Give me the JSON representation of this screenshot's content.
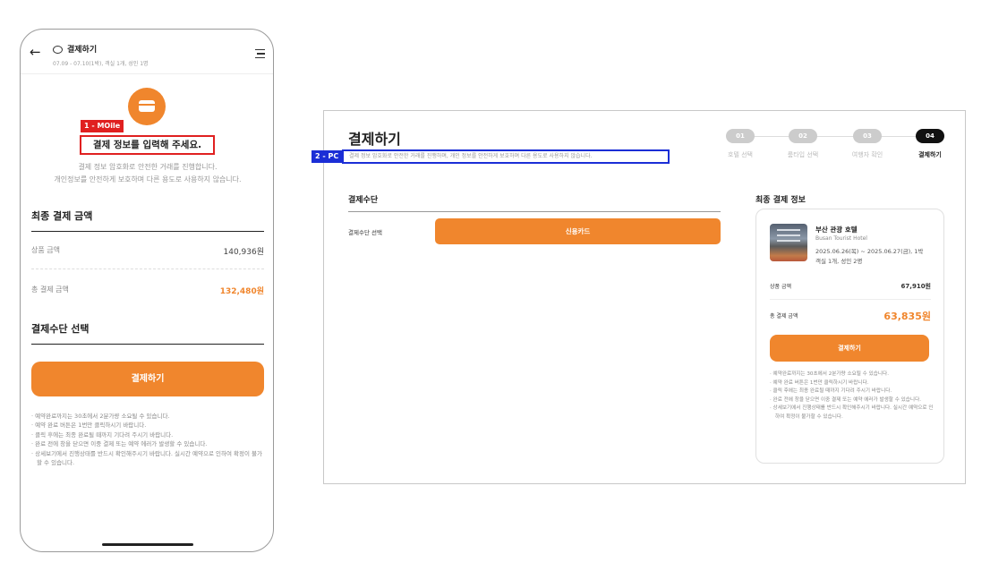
{
  "mobile": {
    "header": {
      "title": "결제하기",
      "subtitle": "07.09 - 07.10(1박), 객실 1개, 성인 1명"
    },
    "badge": "1 - MOile",
    "main_title": "결제 정보를 입력해 주세요.",
    "description_line1": "결제 정보 암호화로 안전한 거래를 진행합니다.",
    "description_line2": "개인정보를 안전하게 보호하며 다른 용도로 사용하지 않습니다.",
    "final_amount_title": "최종 결제 금액",
    "product_label": "상품 금액",
    "product_value": "140,936원",
    "total_label": "총 결제 금액",
    "total_value": "132,480원",
    "payment_method_title": "결제수단 선택",
    "pay_button": "결제하기",
    "notes": [
      "· 예약완료까지는 30초에서 2분가량 소요될 수 있습니다.",
      "· 예약 완료 버튼은 1번만 클릭하시기 바랍니다.",
      "· 클릭 후에는 최종 완료될 때까지 기다려 주시기 바랍니다.",
      "· 완료 전에 창을 닫으면 이중 결제 또는 예약 에러가 발생할 수 있습니다.",
      "· 상세보기에서 진행상태를 반드시 확인해주시기 바랍니다. 실시간 예약으로 인하여 확정이 불가할 수 있습니다."
    ]
  },
  "pc": {
    "title": "결제하기",
    "badge": "2 - PC",
    "description": "결제 정보 암호화로 안전한 거래를 진행하며, 개인 정보를 안전하게 보호하며 다른 용도로 사용하지 않습니다.",
    "steps": [
      {
        "num": "01",
        "label": "호텔 선택"
      },
      {
        "num": "02",
        "label": "룸타입 선택"
      },
      {
        "num": "03",
        "label": "여행자 확인"
      },
      {
        "num": "04",
        "label": "결제하기"
      }
    ],
    "payment_section_title": "결제수단",
    "payment_method_label": "결제수단 선택",
    "credit_card_button": "신용카드",
    "summary": {
      "title": "최종 결제 정보",
      "hotel_name": "부산 관광 호텔",
      "hotel_name_en": "Busan Tourist Hotel",
      "dates": "2025.06.26(목) ~ 2025.06.27(금), 1박",
      "rooms": "객실 1개, 성인 2명",
      "product_label": "상품 금액",
      "product_value": "67,910원",
      "total_label": "총 결제 금액",
      "total_value": "63,835원",
      "pay_button": "결제하기",
      "notes": [
        "· 예약완료까지는 30초에서 2분가량 소요될 수 있습니다.",
        "· 예약 완료 버튼은 1번만 클릭하시기 바랍니다.",
        "· 클릭 후에는 최종 완료될 때까지 기다려 주시기 바랍니다.",
        "· 완료 전에 창을 닫으면 이중 결제 또는 예약 에러가 발생할 수 있습니다.",
        "· 상세보기에서 진행상태를 반드시 확인해주시기 바랍니다. 실시간 예약으로 인하여 확정이 불가할 수 있습니다."
      ]
    }
  },
  "colors": {
    "accent": "#f0862d",
    "mobile_highlight": "#e02020",
    "pc_highlight": "#1b2ed6"
  }
}
